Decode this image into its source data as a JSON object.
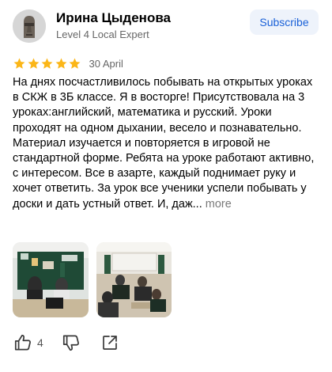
{
  "author": {
    "name": "Ирина Цыденова",
    "level": "Level 4 Local Expert",
    "avatar_icon": "moai-avatar-icon"
  },
  "subscribe_label": "Subscribe",
  "review": {
    "rating": 5,
    "rating_max": 5,
    "date": "30 April",
    "text": "На днях посчастливилось побывать на открытых уроках в СКЖ в 3Б классе. Я в восторге! Присутствовала на 3 уроках:английский, математика и русский. Уроки проходят на одном дыхании, весело и познавательно. Материал изучается и повторяется в игровой не стандартной форме. Ребята на уроке работают активно, с интересом. Все в азарте, каждый поднимает руку и хочет ответить. За урок все ученики успели побывать у доски и дать устный ответ. И, даж...",
    "more_label": "more"
  },
  "photos": [
    {
      "icon": "classroom-board-photo"
    },
    {
      "icon": "classroom-desks-photo"
    }
  ],
  "actions": {
    "like_count": "4",
    "like_icon": "thumbs-up-icon",
    "dislike_icon": "thumbs-down-icon",
    "share_icon": "share-icon"
  },
  "colors": {
    "star": "#fbb618",
    "subscribe_bg": "#eef3fb",
    "subscribe_text": "#1a61d8",
    "secondary_text": "#666666"
  }
}
